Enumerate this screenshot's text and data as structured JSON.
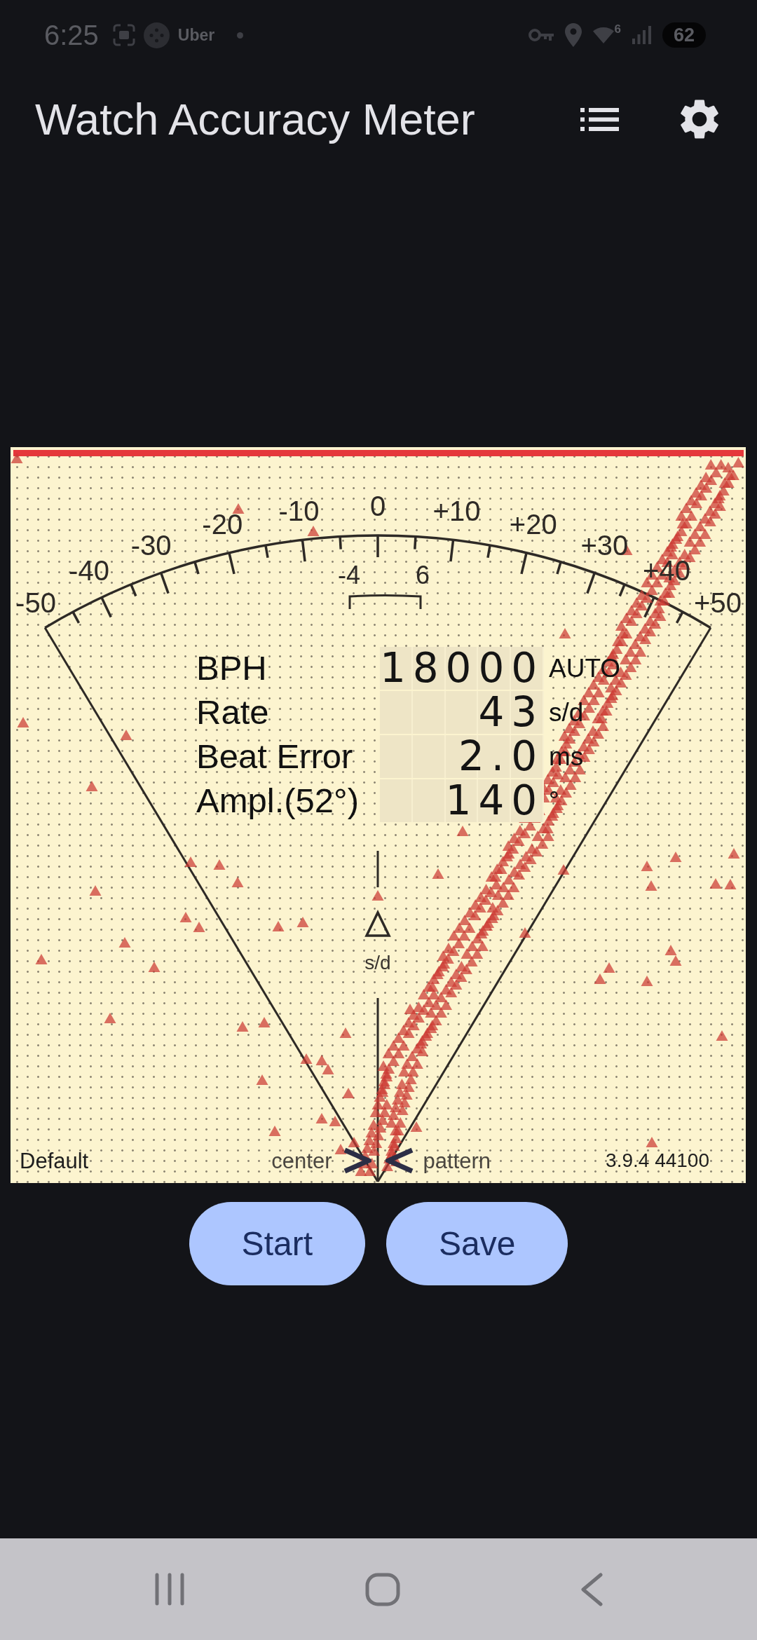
{
  "status_bar": {
    "time": "6:25",
    "notification_app": "Uber",
    "wifi_generation": "6",
    "battery": "62"
  },
  "app_bar": {
    "title": "Watch Accuracy Meter"
  },
  "meter": {
    "scale_labels": [
      "-50",
      "-40",
      "-30",
      "-20",
      "-10",
      "0",
      "+10",
      "+20",
      "+30",
      "+40",
      "+50"
    ],
    "tolerance_labels": [
      "-4",
      "6"
    ],
    "rate_unit": "s/d",
    "readouts": [
      {
        "label": "BPH",
        "value": "18000",
        "unit": "AUTO"
      },
      {
        "label": "Rate",
        "value": "43",
        "unit": "s/d"
      },
      {
        "label": "Beat Error",
        "value": "2.0",
        "unit": "ms"
      },
      {
        "label": "Ampl.(52°)",
        "value": "140",
        "unit": "°"
      }
    ],
    "footer": {
      "profile": "Default",
      "center_hint": "center",
      "pattern_hint": "pattern",
      "version": "3.9.4 44100"
    }
  },
  "buttons": [
    {
      "label": "Start"
    },
    {
      "label": "Save"
    }
  ]
}
